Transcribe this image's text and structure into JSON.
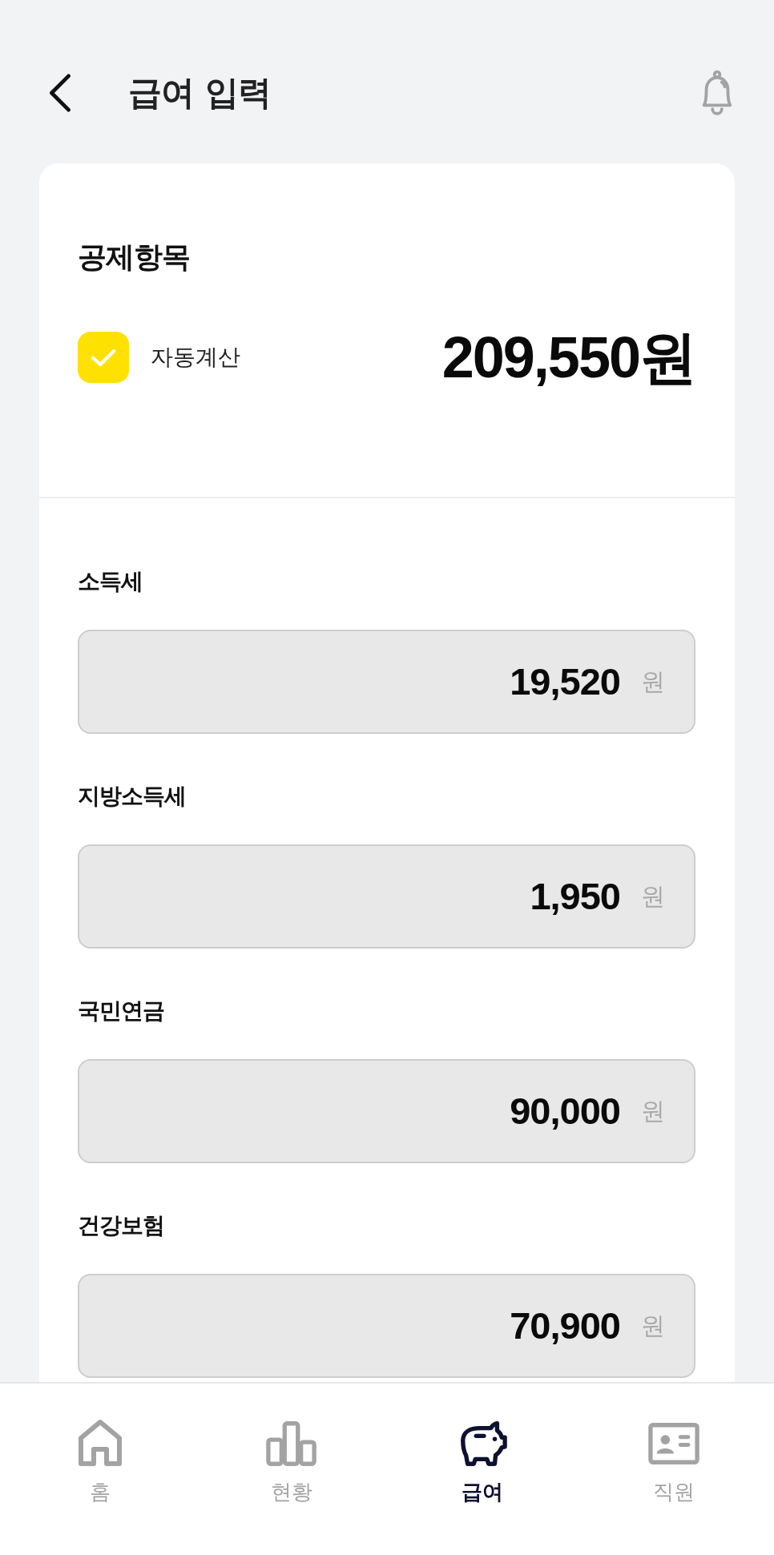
{
  "header": {
    "title": "급여 입력"
  },
  "deduction": {
    "title": "공제항목",
    "auto_calc": {
      "label": "자동계산",
      "checked": true
    },
    "total": "209,550원",
    "items": [
      {
        "label": "소득세",
        "value": "19,520",
        "unit": "원",
        "disabled": true
      },
      {
        "label": "지방소득세",
        "value": "1,950",
        "unit": "원",
        "disabled": true
      },
      {
        "label": "국민연금",
        "value": "90,000",
        "unit": "원",
        "disabled": true
      },
      {
        "label": "건강보험",
        "value": "70,900",
        "unit": "원",
        "disabled": true
      }
    ]
  },
  "nav": [
    {
      "label": "홈",
      "selected": false
    },
    {
      "label": "현황",
      "selected": false
    },
    {
      "label": "급여",
      "selected": true
    },
    {
      "label": "직원",
      "selected": false
    }
  ]
}
